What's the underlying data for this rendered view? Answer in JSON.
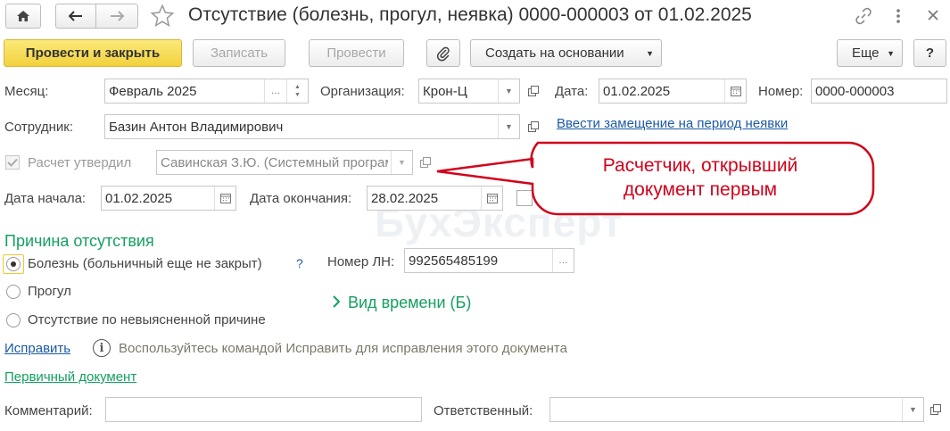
{
  "window": {
    "title": "Отсутствие (болезнь, прогул, неявка) 0000-000003 от 01.02.2025",
    "icons": [
      "home-icon",
      "back-arrow-icon",
      "forward-arrow-icon",
      "star-icon",
      "link-icon",
      "more-vert-icon",
      "close-icon"
    ]
  },
  "toolbar": {
    "post_close": "Провести и закрыть",
    "save": "Записать",
    "post": "Провести",
    "create_based": "Создать на основании",
    "more": "Еще",
    "help": "?"
  },
  "form": {
    "month_label": "Месяц:",
    "month_value": "Февраль 2025",
    "org_label": "Организация:",
    "org_value": "Крон-Ц",
    "date_label": "Дата:",
    "date_value": "01.02.2025",
    "number_label": "Номер:",
    "number_value": "0000-000003",
    "employee_label": "Сотрудник:",
    "employee_value": "Базин Антон Владимирович",
    "replacement_link": "Ввести замещение на период неявки",
    "approved_label": "Расчет утвердил",
    "approved_value": "Савинская З.Ю. (Системный программист)",
    "start_label": "Дата начала:",
    "start_value": "01.02.2025",
    "end_label": "Дата окончания:",
    "end_value": "28.02.2025",
    "reason_heading": "Причина отсутствия",
    "reasons": [
      "Болезнь (больничный еще не закрыт)",
      "Прогул",
      "Отсутствие по невыясненной причине"
    ],
    "reason_help": "?",
    "sick_number_label": "Номер ЛН:",
    "sick_number_value": "992565485199",
    "time_kind": "Вид времени (Б)",
    "fix_link": "Исправить",
    "fix_hint": "Воспользуйтесь командой Исправить для исправления этого документа",
    "primary_doc_link": "Первичный документ",
    "comment_label": "Комментарий:",
    "comment_value": "",
    "responsible_label": "Ответственный:",
    "responsible_value": ""
  },
  "callout": {
    "text_line1": "Расчетчик, открывший",
    "text_line2": "документ первым"
  },
  "watermark": "БухЭксперт",
  "colors": {
    "accent_green": "#13a060",
    "link_blue": "#1c5aa6",
    "callout_red": "#d0021b",
    "primary_yellow": "#f5d84a"
  }
}
